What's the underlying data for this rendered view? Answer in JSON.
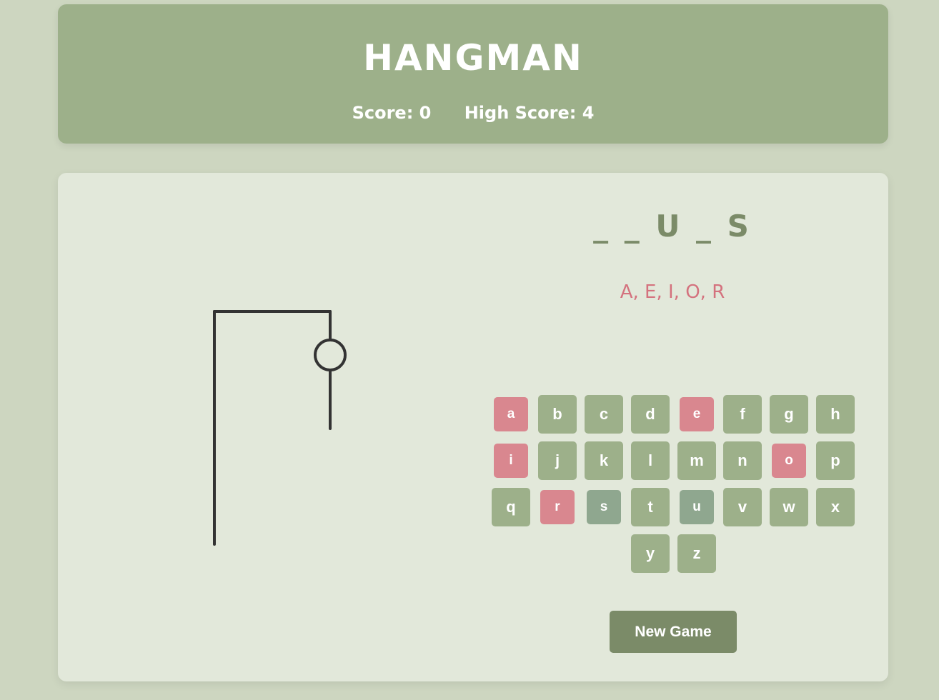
{
  "game": {
    "title": "HANGMAN",
    "score_label": "Score: 0",
    "high_score_label": "High Score: 4",
    "word_display": "_ _ U _ S",
    "wrong_guesses": "A, E, I, O, R",
    "new_game_label": "New Game"
  },
  "keyboard": {
    "keys": [
      {
        "letter": "a",
        "state": "wrong"
      },
      {
        "letter": "b",
        "state": "available"
      },
      {
        "letter": "c",
        "state": "available"
      },
      {
        "letter": "d",
        "state": "available"
      },
      {
        "letter": "e",
        "state": "wrong"
      },
      {
        "letter": "f",
        "state": "available"
      },
      {
        "letter": "g",
        "state": "available"
      },
      {
        "letter": "h",
        "state": "available"
      },
      {
        "letter": "i",
        "state": "wrong"
      },
      {
        "letter": "j",
        "state": "available"
      },
      {
        "letter": "k",
        "state": "available"
      },
      {
        "letter": "l",
        "state": "available"
      },
      {
        "letter": "m",
        "state": "available"
      },
      {
        "letter": "n",
        "state": "available"
      },
      {
        "letter": "o",
        "state": "wrong"
      },
      {
        "letter": "p",
        "state": "available"
      },
      {
        "letter": "q",
        "state": "available"
      },
      {
        "letter": "r",
        "state": "wrong"
      },
      {
        "letter": "s",
        "state": "correct"
      },
      {
        "letter": "t",
        "state": "available"
      },
      {
        "letter": "u",
        "state": "correct"
      },
      {
        "letter": "v",
        "state": "available"
      },
      {
        "letter": "w",
        "state": "available"
      },
      {
        "letter": "x",
        "state": "available"
      },
      {
        "letter": "y",
        "state": "available"
      },
      {
        "letter": "z",
        "state": "available"
      }
    ]
  },
  "drawing": {
    "parts_shown": [
      "gallows-post",
      "gallows-beam",
      "rope",
      "head",
      "body"
    ]
  },
  "colors": {
    "background": "#cdd6c0",
    "header": "#9db08a",
    "panel": "#e2e8da",
    "key_available": "#9db08a",
    "key_wrong": "#d9878f",
    "key_correct": "#8fa78f",
    "word_text": "#7b8b68",
    "wrong_text": "#d4727e",
    "button": "#7b8b68"
  }
}
